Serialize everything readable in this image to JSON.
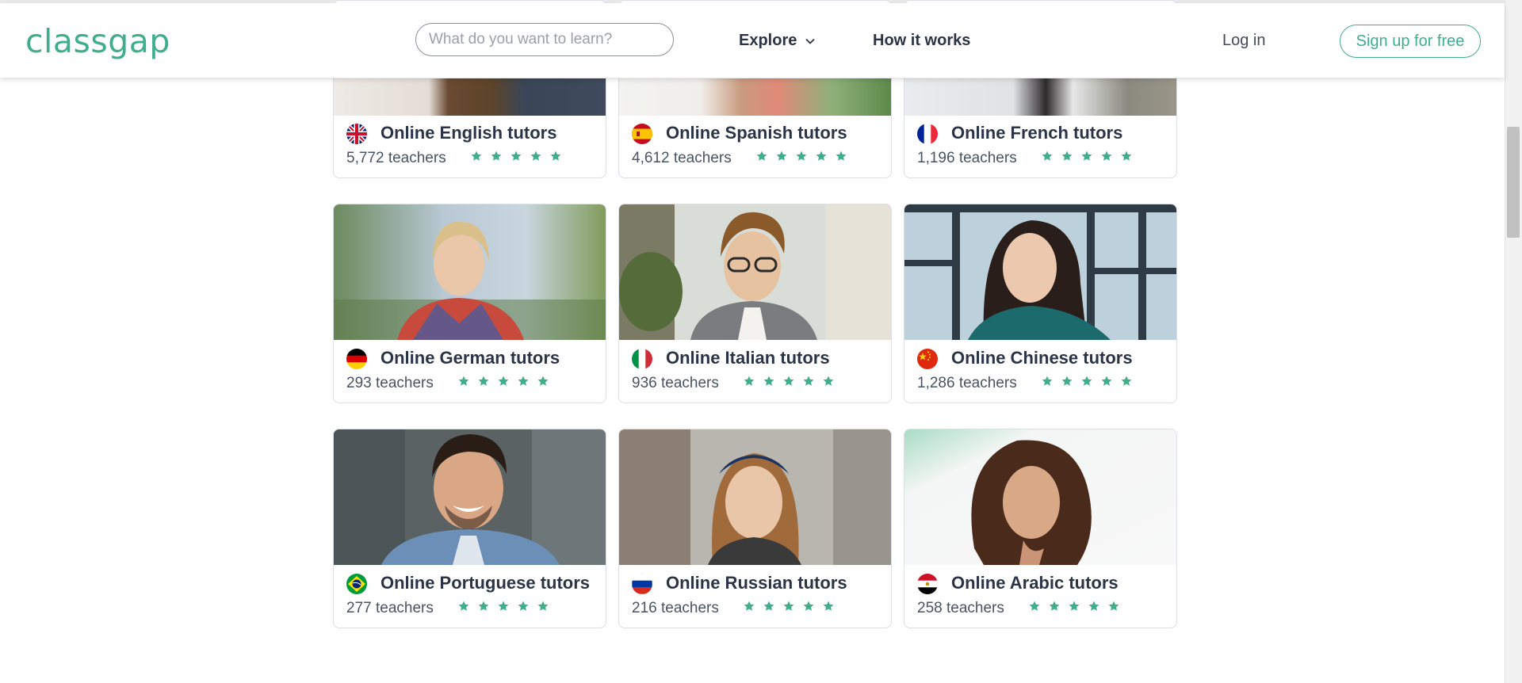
{
  "header": {
    "logo": "classgap",
    "search_placeholder": "What do you want to learn?",
    "explore_label": "Explore",
    "how_label": "How it works",
    "login_label": "Log in",
    "signup_label": "Sign up for free"
  },
  "colors": {
    "brand": "#3fae8c",
    "text": "#2b3446",
    "star": "#3fae8c"
  },
  "cards": [
    {
      "title": "Online English tutors",
      "teachers": "5,772 teachers",
      "flag": "uk-flag-icon",
      "rating_stars": 5
    },
    {
      "title": "Online Spanish tutors",
      "teachers": "4,612 teachers",
      "flag": "spain-flag-icon",
      "rating_stars": 5
    },
    {
      "title": "Online French tutors",
      "teachers": "1,196 teachers",
      "flag": "france-flag-icon",
      "rating_stars": 5
    },
    {
      "title": "Online German tutors",
      "teachers": "293 teachers",
      "flag": "germany-flag-icon",
      "rating_stars": 5
    },
    {
      "title": "Online Italian tutors",
      "teachers": "936 teachers",
      "flag": "italy-flag-icon",
      "rating_stars": 5
    },
    {
      "title": "Online Chinese tutors",
      "teachers": "1,286 teachers",
      "flag": "china-flag-icon",
      "rating_stars": 5
    },
    {
      "title": "Online Portuguese tutors",
      "teachers": "277 teachers",
      "flag": "brazil-flag-icon",
      "rating_stars": 5
    },
    {
      "title": "Online Russian tutors",
      "teachers": "216 teachers",
      "flag": "russia-flag-icon",
      "rating_stars": 5
    },
    {
      "title": "Online Arabic tutors",
      "teachers": "258 teachers",
      "flag": "egypt-flag-icon",
      "rating_stars": 5
    }
  ]
}
